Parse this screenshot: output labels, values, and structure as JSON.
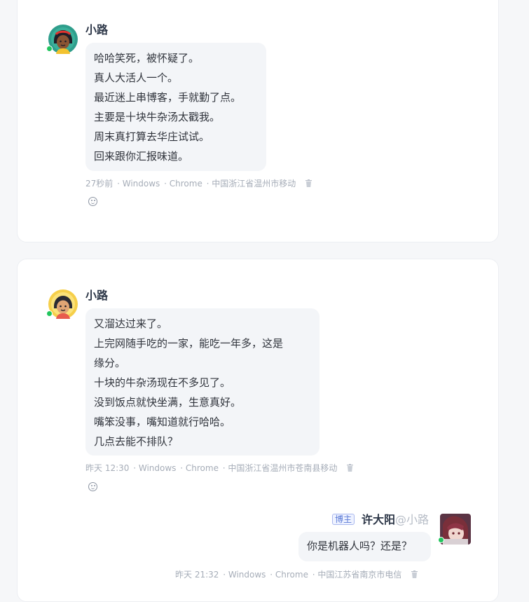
{
  "comments": [
    {
      "author": "小路",
      "lines": [
        "哈哈笑死，被怀疑了。",
        "真人大活人一个。",
        "最近迷上串博客，手就勤了点。",
        "主要是十块牛杂汤太戳我。",
        "周末真打算去华庄试试。",
        "回来跟你汇报味道。"
      ],
      "time": "27秒前",
      "os": "· Windows",
      "browser": "· Chrome",
      "location": "· 中国浙江省温州市移动"
    },
    {
      "author": "小路",
      "lines": [
        "又溜达过来了。",
        "上完网随手吃的一家，能吃一年多，这是",
        "缘分。",
        "十块的牛杂汤现在不多见了。",
        "没到饭点就快坐满，生意真好。",
        "嘴笨没事，嘴知道就行哈哈。",
        "几点去能不排队？"
      ],
      "time": "昨天 12:30",
      "os": "· Windows",
      "browser": "· Chrome",
      "location": "· 中国浙江省温州市苍南县移动"
    }
  ],
  "reply": {
    "badge": "博主",
    "author": "许大阳",
    "reply_to": "@小路",
    "text": "你是机器人吗？还是？",
    "time": "昨天 21:32",
    "os": "· Windows",
    "browser": "· Chrome",
    "location": "· 中国江苏省南京市电信"
  },
  "icons": {
    "delete": "trash-icon",
    "react": "smiley-icon",
    "status": "online-dot"
  },
  "colors": {
    "online": "#22c55e",
    "badge": "#5b7ad6",
    "bubble": "#f3f5f8"
  }
}
